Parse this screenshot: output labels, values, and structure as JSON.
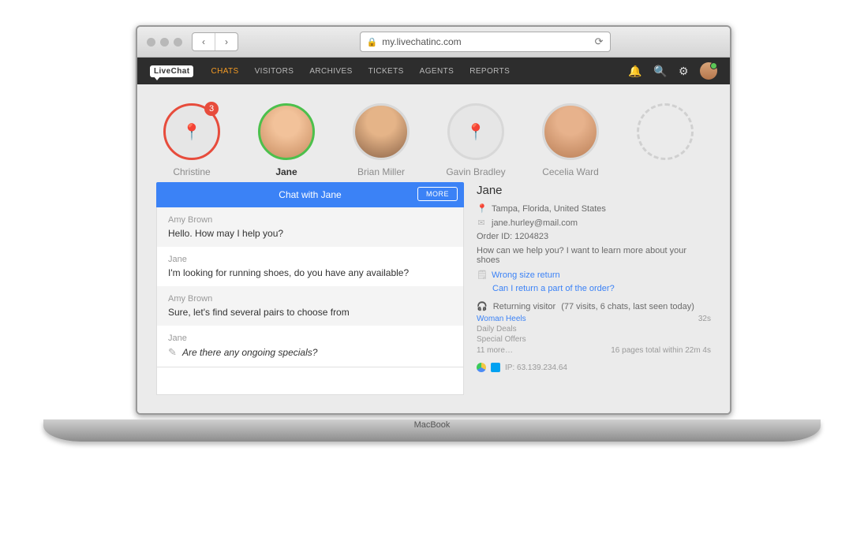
{
  "browser": {
    "url_prefix_lock": "🔒",
    "url": "my.livechatinc.com",
    "refresh_glyph": "⟳",
    "back_glyph": "‹",
    "forward_glyph": "›"
  },
  "laptop_brand": "MacBook",
  "header": {
    "logo_text_a": "Live",
    "logo_text_b": "Chat",
    "nav": [
      "CHATS",
      "VISITORS",
      "ARCHIVES",
      "TICKETS",
      "AGENTS",
      "REPORTS"
    ],
    "active_nav_index": 0,
    "icons": {
      "bell": "🔔",
      "search": "🔍",
      "gear": "⚙"
    }
  },
  "visitors": [
    {
      "name": "Christine",
      "ring": "red",
      "badge": "3",
      "avatar_type": "map"
    },
    {
      "name": "Jane",
      "ring": "green",
      "avatar_type": "face1",
      "active": true
    },
    {
      "name": "Brian Miller",
      "ring": "grey",
      "avatar_type": "face2"
    },
    {
      "name": "Gavin Bradley",
      "ring": "grey",
      "avatar_type": "map"
    },
    {
      "name": "Cecelia Ward",
      "ring": "grey",
      "avatar_type": "face3"
    },
    {
      "name": "",
      "ring": "dashed",
      "avatar_type": "empty"
    }
  ],
  "chat": {
    "header_title": "Chat with Jane",
    "more_label": "MORE",
    "messages": [
      {
        "sender": "Amy Brown",
        "text": "Hello. How may I help you?",
        "grey": true
      },
      {
        "sender": "Jane",
        "text": "I'm looking for running shoes, do you have any available?"
      },
      {
        "sender": "Amy Brown",
        "text": "Sure, let's find several pairs to choose from",
        "grey": true
      },
      {
        "sender": "Jane",
        "text": "Are there any ongoing specials?",
        "typing": true
      }
    ],
    "input_placeholder": ""
  },
  "info": {
    "name": "Jane",
    "location": "Tampa, Florida, United States",
    "email": "jane.hurley@mail.com",
    "order_label": "Order ID: 1204823",
    "question": "How can we help you? I want to learn more about your shoes",
    "ticket_title": "Wrong size return",
    "ticket_sub": "Can I return a part of the order?",
    "visitor_type": "Returning visitor",
    "visit_stats": "(77 visits, 6 chats, last seen today)",
    "pages": [
      {
        "title": "Woman Heels",
        "link": true,
        "time": "32s"
      },
      {
        "title": "Daily Deals"
      },
      {
        "title": "Special Offers"
      }
    ],
    "pages_more": "11 more…",
    "pages_total": "16 pages total within 22m 4s",
    "ip_label": "IP: 63.139.234.64"
  },
  "icons": {
    "pin": "📍",
    "mail": "✉",
    "ticket": "🗒",
    "headset": "🎧",
    "quill": "✎"
  }
}
